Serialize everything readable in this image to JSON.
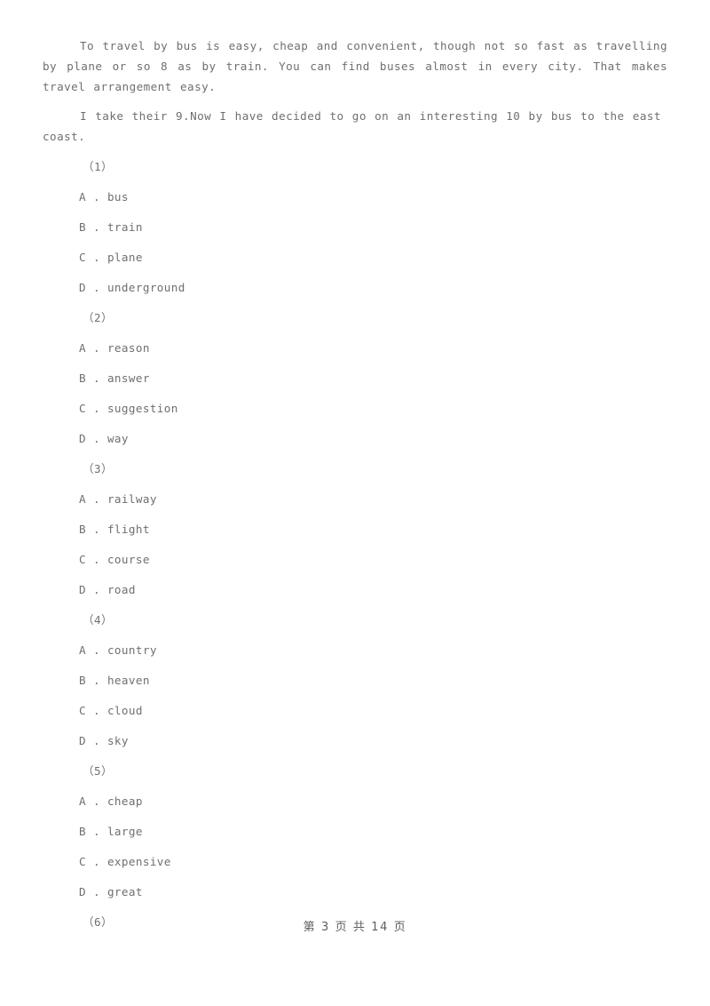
{
  "document": {
    "type": "exam-worksheet",
    "text_color": "#6f6f6f",
    "background_color": "#ffffff"
  },
  "passage": {
    "paragraph_1": "To travel by bus is easy, cheap and convenient, though not so fast as travelling by plane or so 8 as by train. You can find buses almost in every city. That makes travel arrangement easy.",
    "paragraph_2": "I take their 9.Now I have decided to go on an interesting 10 by bus to the east coast."
  },
  "questions": [
    {
      "number": "（1）",
      "options": [
        {
          "letter": "A",
          "sep": " . ",
          "text": "bus"
        },
        {
          "letter": "B",
          "sep": " . ",
          "text": "train"
        },
        {
          "letter": "C",
          "sep": " . ",
          "text": "plane"
        },
        {
          "letter": "D",
          "sep": " . ",
          "text": "underground"
        }
      ]
    },
    {
      "number": "（2）",
      "options": [
        {
          "letter": "A",
          "sep": " . ",
          "text": "reason"
        },
        {
          "letter": "B",
          "sep": " . ",
          "text": "answer"
        },
        {
          "letter": "C",
          "sep": " . ",
          "text": "suggestion"
        },
        {
          "letter": "D",
          "sep": " . ",
          "text": "way"
        }
      ]
    },
    {
      "number": "（3）",
      "options": [
        {
          "letter": "A",
          "sep": " . ",
          "text": "railway"
        },
        {
          "letter": "B",
          "sep": " . ",
          "text": "flight"
        },
        {
          "letter": "C",
          "sep": " . ",
          "text": "course"
        },
        {
          "letter": "D",
          "sep": " . ",
          "text": "road"
        }
      ]
    },
    {
      "number": "（4）",
      "options": [
        {
          "letter": "A",
          "sep": " . ",
          "text": "country"
        },
        {
          "letter": "B",
          "sep": " . ",
          "text": "heaven"
        },
        {
          "letter": "C",
          "sep": " . ",
          "text": "cloud"
        },
        {
          "letter": "D",
          "sep": " . ",
          "text": "sky"
        }
      ]
    },
    {
      "number": "（5）",
      "options": [
        {
          "letter": "A",
          "sep": " . ",
          "text": "cheap"
        },
        {
          "letter": "B",
          "sep": " . ",
          "text": "large"
        },
        {
          "letter": "C",
          "sep": " . ",
          "text": "expensive"
        },
        {
          "letter": "D",
          "sep": " . ",
          "text": "great"
        }
      ]
    },
    {
      "number": "（6）",
      "options": []
    }
  ],
  "footer": {
    "prefix": "第",
    "current_page": "3",
    "middle": "页 共",
    "total_pages": "14",
    "suffix": "页",
    "full_text": "第 3 页 共 14 页"
  }
}
